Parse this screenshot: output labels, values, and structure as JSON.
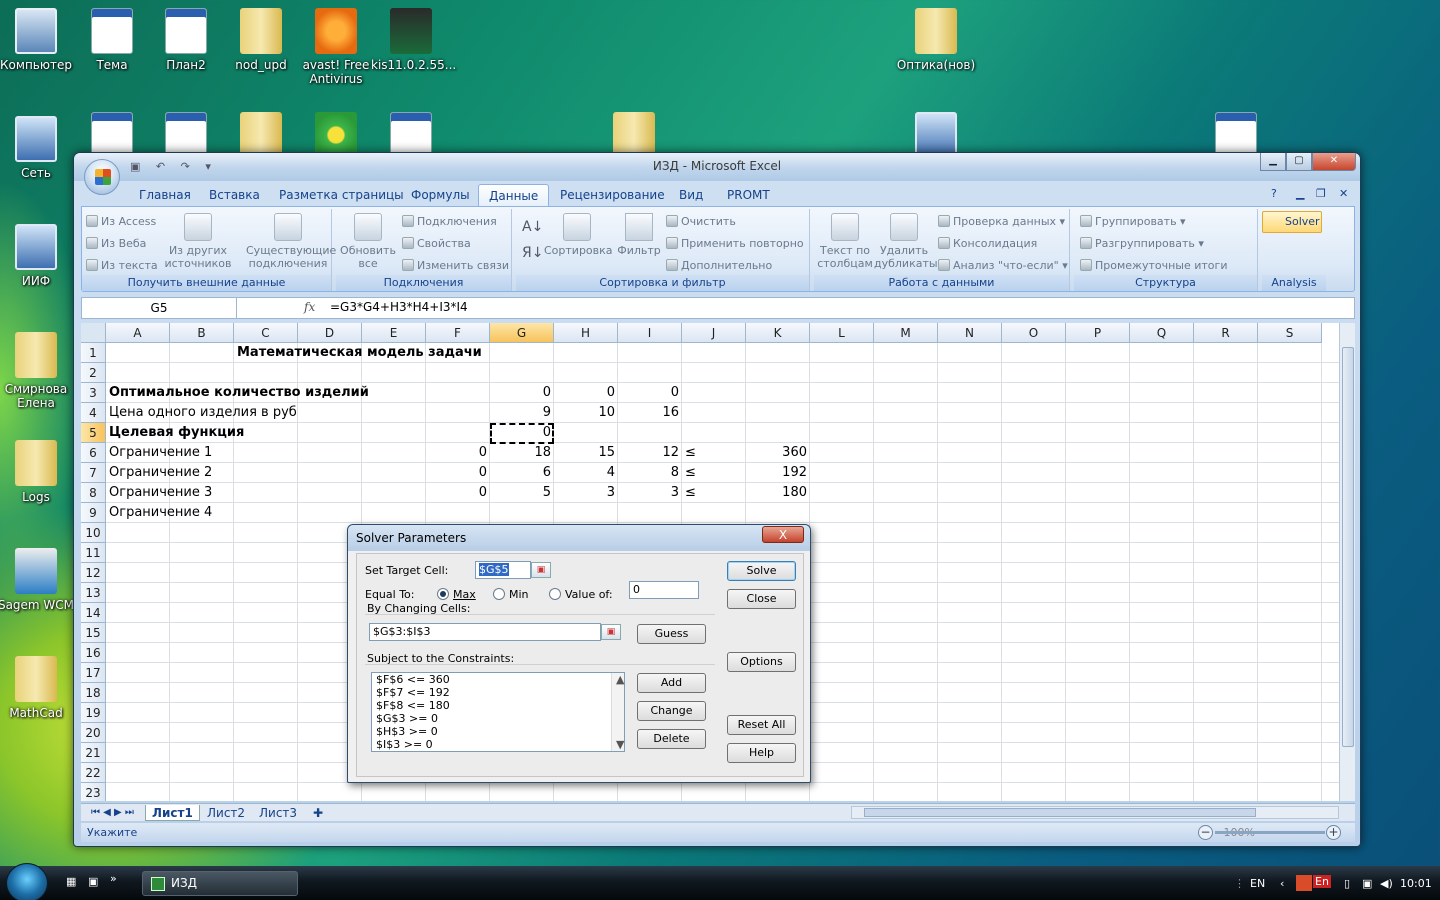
{
  "desktop": {
    "icons": [
      {
        "label": "Компьютер",
        "icon": "computer-icon"
      },
      {
        "label": "Тема",
        "icon": "word-doc-icon"
      },
      {
        "label": "План2",
        "icon": "word-doc-icon"
      },
      {
        "label": "nod_upd",
        "icon": "folder-icon"
      },
      {
        "label": "avast! Free Antivirus",
        "icon": "avast-icon"
      },
      {
        "label": "kis11.0.2.55...",
        "icon": "kaspersky-icon"
      },
      {
        "label": "Оптика(нов)",
        "icon": "folder-icon"
      },
      {
        "label": "Сеть",
        "icon": "network-icon"
      },
      {
        "label": "ИИФ",
        "icon": "network-icon"
      },
      {
        "label": "Смирнова Елена",
        "icon": "folder-icon"
      },
      {
        "label": "Logs",
        "icon": "folder-icon"
      },
      {
        "label": "Sagem WCM",
        "icon": "app-icon"
      },
      {
        "label": "MathCad",
        "icon": "folder-icon"
      }
    ]
  },
  "excel": {
    "title": "ИЗД - Microsoft Excel",
    "tabs": [
      "Главная",
      "Вставка",
      "Разметка страницы",
      "Формулы",
      "Данные",
      "Рецензирование",
      "Вид",
      "PROMT"
    ],
    "active_tab": "Данные",
    "groups": {
      "external": {
        "label": "Получить внешние данные",
        "from_access": "Из Access",
        "from_web": "Из Веба",
        "from_text": "Из текста",
        "from_other": "Из других источников",
        "existing": "Существующие подключения"
      },
      "connections": {
        "label": "Подключения",
        "refresh": "Обновить все",
        "connections": "Подключения",
        "properties": "Свойства",
        "edit_links": "Изменить связи"
      },
      "sort": {
        "label": "Сортировка и фильтр",
        "sort": "Сортировка",
        "filter": "Фильтр",
        "clear": "Очистить",
        "reapply": "Применить повторно",
        "advanced": "Дополнительно"
      },
      "data_tools": {
        "label": "Работа с данными",
        "text_to_columns": "Текст по столбцам",
        "remove_dup": "Удалить дубликаты",
        "validation": "Проверка данных",
        "consolidate": "Консолидация",
        "whatif": "Анализ \"что-если\""
      },
      "outline": {
        "label": "Структура",
        "group": "Группировать",
        "ungroup": "Разгруппировать",
        "subtotal": "Промежуточные итоги"
      },
      "analysis": {
        "label": "Analysis",
        "solver": "Solver"
      }
    },
    "name_box": "G5",
    "fx_label": "fx",
    "formula": "=G3*G4+H3*H4+I3*I4",
    "columns": [
      "A",
      "B",
      "C",
      "D",
      "E",
      "F",
      "G",
      "H",
      "I",
      "J",
      "K",
      "L",
      "M",
      "N",
      "O",
      "P",
      "Q",
      "R",
      "S"
    ],
    "rows": [
      "1",
      "2",
      "3",
      "4",
      "5",
      "6",
      "7",
      "8",
      "9",
      "10",
      "11",
      "12",
      "13",
      "14",
      "15",
      "16",
      "17",
      "18",
      "19",
      "20",
      "21",
      "22",
      "23"
    ],
    "cells": {
      "c1": "Математическая модель задачи",
      "a3": "Оптимальное количество изделий",
      "g3": "0",
      "h3": "0",
      "i3": "0",
      "a4": "Цена одного изделия в руб",
      "g4": "9",
      "h4": "10",
      "i4": "16",
      "a5": "Целевая функция",
      "g5": "0",
      "a6": "Ограничение 1",
      "f6": "0",
      "g6": "18",
      "h6": "15",
      "i6": "12",
      "j6": "≤",
      "k6": "360",
      "a7": "Ограничение 2",
      "f7": "0",
      "g7": "6",
      "h7": "4",
      "i7": "8",
      "j7": "≤",
      "k7": "192",
      "a8": "Ограничение 3",
      "f8": "0",
      "g8": "5",
      "h8": "3",
      "i8": "3",
      "j8": "≤",
      "k8": "180",
      "a9": "Ограничение 4"
    },
    "sheets": [
      "Лист1",
      "Лист2",
      "Лист3"
    ],
    "active_sheet": "Лист1",
    "status": "Укажите",
    "zoom": "100%"
  },
  "solver": {
    "title": "Solver Parameters",
    "close_x": "X",
    "set_target_label": "Set Target Cell:",
    "target": "$G$5",
    "equal_to_label": "Equal To:",
    "max_label": "Max",
    "min_label": "Min",
    "value_of_label": "Value of:",
    "value_of": "0",
    "changing_label": "By Changing Cells:",
    "changing": "$G$3:$I$3",
    "constraints_label": "Subject to the Constraints:",
    "constraints": [
      "$F$6 <= 360",
      "$F$7 <= 192",
      "$F$8 <= 180",
      "$G$3 >= 0",
      "$H$3 >= 0",
      "$I$3 >= 0"
    ],
    "buttons": {
      "solve": "Solve",
      "close": "Close",
      "options": "Options",
      "guess": "Guess",
      "add": "Add",
      "change": "Change",
      "delete": "Delete",
      "reset": "Reset All",
      "help": "Help"
    }
  },
  "taskbar": {
    "task": "ИЗД",
    "lang": "EN",
    "lang_tray": "En",
    "clock": "10:01"
  }
}
